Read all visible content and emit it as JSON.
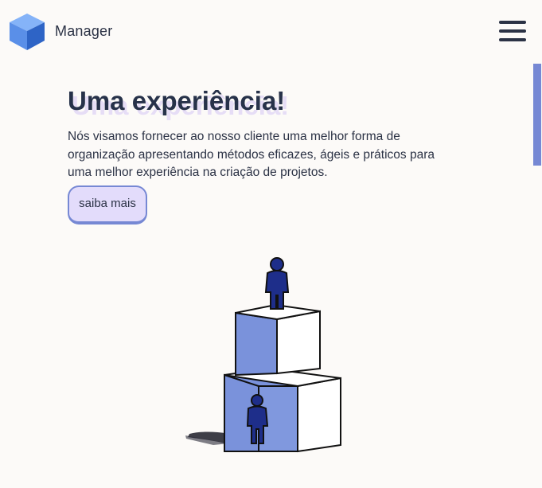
{
  "header": {
    "brand": "Manager",
    "logo_icon": "cube-logo-icon",
    "menu_icon": "hamburger-menu-icon"
  },
  "hero": {
    "title": "Uma experiência!",
    "description": "Nós visamos fornecer ao nosso cliente uma melhor forma de organização apresentando métodos eficazes, ágeis e práticos para uma melhor experiência na criação de projetos.",
    "button_label": "saiba mais",
    "illustration": "people-on-stacked-boxes-illustration"
  },
  "colors": {
    "background": "#fcfaf8",
    "text": "#27324a",
    "accent": "#7688d4",
    "button_fill": "#e3dcfb",
    "title_shadow": "#e6ddf6",
    "logo_light": "#6fa0f0",
    "logo_dark": "#3266c8"
  }
}
